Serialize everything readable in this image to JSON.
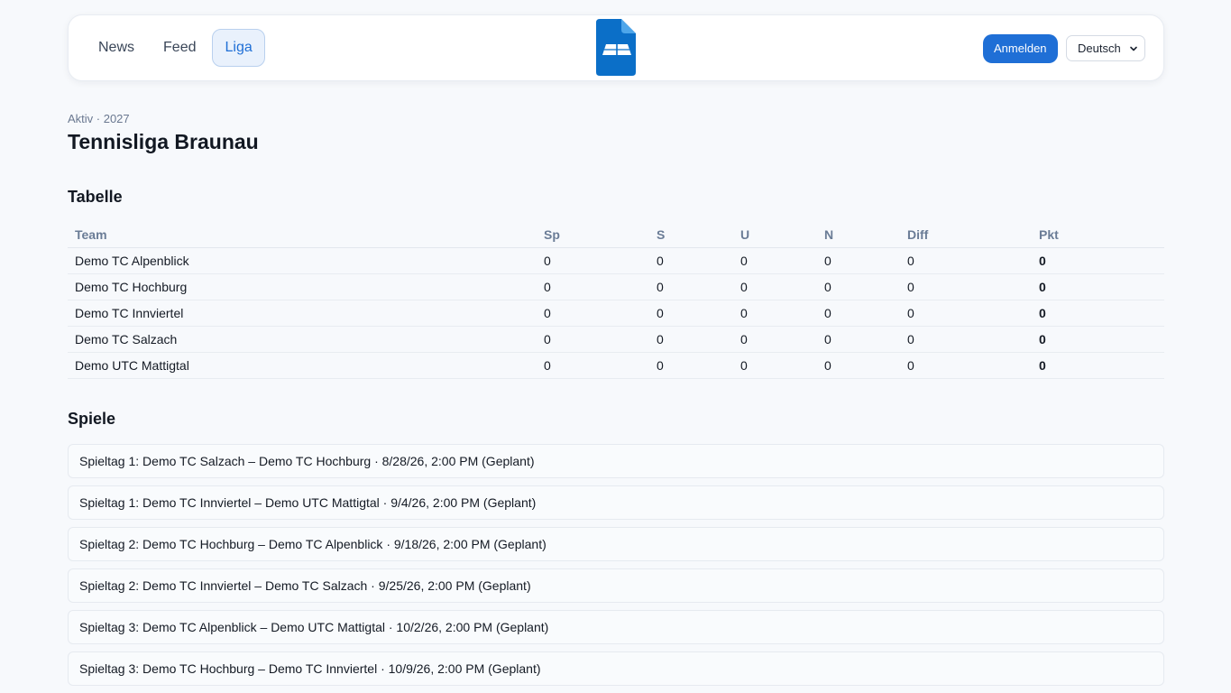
{
  "header": {
    "nav": [
      {
        "label": "News",
        "active": false
      },
      {
        "label": "Feed",
        "active": false
      },
      {
        "label": "Liga",
        "active": true
      }
    ],
    "logo_icon": "tennis-court-document-icon",
    "login_label": "Anmelden",
    "language_selected": "Deutsch"
  },
  "league": {
    "kicker": "Aktiv · 2027",
    "title": "Tennisliga Braunau"
  },
  "standings": {
    "title": "Tabelle",
    "columns": [
      "Team",
      "Sp",
      "S",
      "U",
      "N",
      "Diff",
      "Pkt"
    ],
    "rows": [
      [
        "Demo TC Alpenblick",
        "0",
        "0",
        "0",
        "0",
        "0",
        "0"
      ],
      [
        "Demo TC Hochburg",
        "0",
        "0",
        "0",
        "0",
        "0",
        "0"
      ],
      [
        "Demo TC Innviertel",
        "0",
        "0",
        "0",
        "0",
        "0",
        "0"
      ],
      [
        "Demo TC Salzach",
        "0",
        "0",
        "0",
        "0",
        "0",
        "0"
      ],
      [
        "Demo UTC Mattigtal",
        "0",
        "0",
        "0",
        "0",
        "0",
        "0"
      ]
    ]
  },
  "matches": {
    "title": "Spiele",
    "items": [
      "Spieltag 1: Demo TC Salzach – Demo TC Hochburg · 8/28/26, 2:00 PM (Geplant)",
      "Spieltag 1: Demo TC Innviertel – Demo UTC Mattigtal · 9/4/26, 2:00 PM (Geplant)",
      "Spieltag 2: Demo TC Hochburg – Demo TC Alpenblick · 9/18/26, 2:00 PM (Geplant)",
      "Spieltag 2: Demo TC Innviertel – Demo TC Salzach · 9/25/26, 2:00 PM (Geplant)",
      "Spieltag 3: Demo TC Alpenblick – Demo UTC Mattigtal · 10/2/26, 2:00 PM (Geplant)",
      "Spieltag 3: Demo TC Hochburg – Demo TC Innviertel · 10/9/26, 2:00 PM (Geplant)"
    ]
  },
  "colors": {
    "accent": "#1f6fd6",
    "logo_dark": "#0b6fc8",
    "logo_light": "#4ea6ea",
    "background": "#f7f9fc"
  }
}
